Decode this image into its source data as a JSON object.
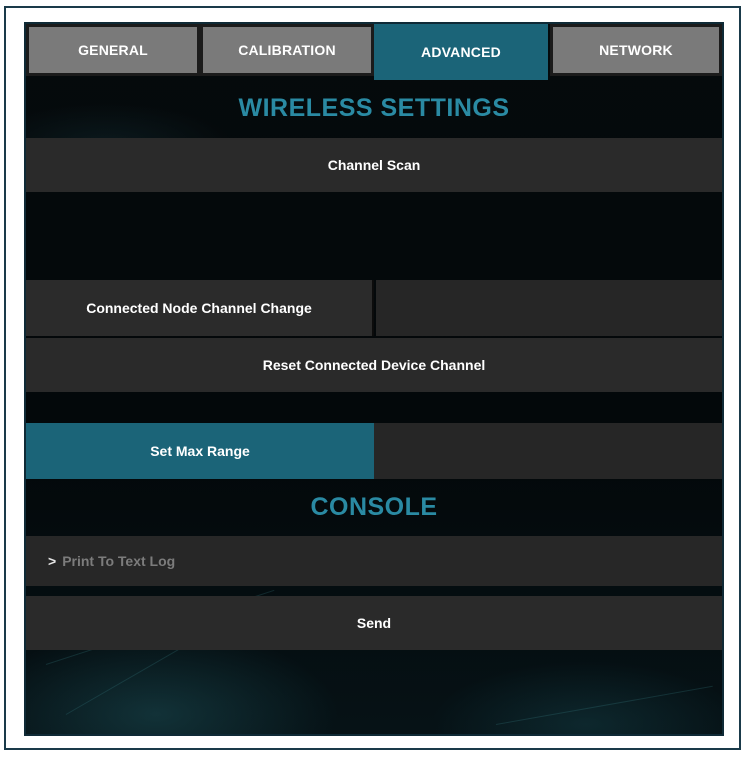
{
  "tabs": [
    {
      "label": "GENERAL",
      "active": false
    },
    {
      "label": "CALIBRATION",
      "active": false
    },
    {
      "label": "ADVANCED",
      "active": true
    },
    {
      "label": "NETWORK",
      "active": false
    }
  ],
  "wireless": {
    "title": "WIRELESS SETTINGS",
    "channel_scan_label": "Channel Scan",
    "node_channel_change_label": "Connected Node Channel Change",
    "node_channel_value": "",
    "reset_channel_label": "Reset Connected Device Channel",
    "max_range_label": "Set Max Range",
    "max_range_value": ""
  },
  "console": {
    "title": "CONSOLE",
    "prompt": ">",
    "input_value": "",
    "input_placeholder": "Print To Text Log",
    "send_label": "Send"
  },
  "colors": {
    "accent": "#1b6478",
    "title": "#2a8aa3",
    "bar": "#2a2a2a",
    "tab_inactive": "#7a7a7a"
  }
}
